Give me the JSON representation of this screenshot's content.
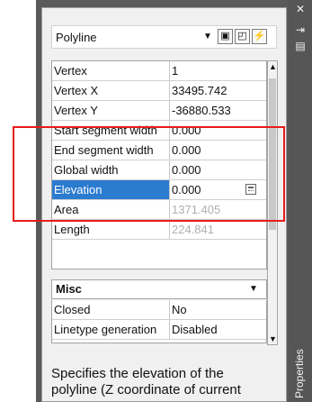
{
  "palette": {
    "object_type": "Polyline",
    "title_vertical": "Properties",
    "toolbar": {
      "toggle_pickadd_icon": "pickadd-icon",
      "select_objects_icon": "select-objects-icon",
      "quick_select_icon": "quick-select-icon"
    },
    "titlebar_icons": [
      "close-icon",
      "autohide-icon",
      "properties-menu-icon"
    ]
  },
  "properties": {
    "rows": [
      {
        "label": "Vertex",
        "value": "1"
      },
      {
        "label": "Vertex X",
        "value": "33495.742"
      },
      {
        "label": "Vertex Y",
        "value": "-36880.533"
      },
      {
        "label": "Start segment width",
        "value": "0.000"
      },
      {
        "label": "End segment width",
        "value": "0.000"
      },
      {
        "label": "Global width",
        "value": "0.000"
      },
      {
        "label": "Elevation",
        "value": "0.000"
      },
      {
        "label": "Area",
        "value": "1371.405"
      },
      {
        "label": "Length",
        "value": "224.841"
      }
    ]
  },
  "misc": {
    "title": "Misc",
    "rows": [
      {
        "label": "Closed",
        "value": "No"
      },
      {
        "label": "Linetype generation",
        "value": "Disabled"
      }
    ]
  },
  "description": "Specifies the elevation of the polyline (Z coordinate of current",
  "colors": {
    "selection": "#2b7bcf",
    "highlight_box": "#e81b1b",
    "palette_dark": "#5a5a5a"
  }
}
